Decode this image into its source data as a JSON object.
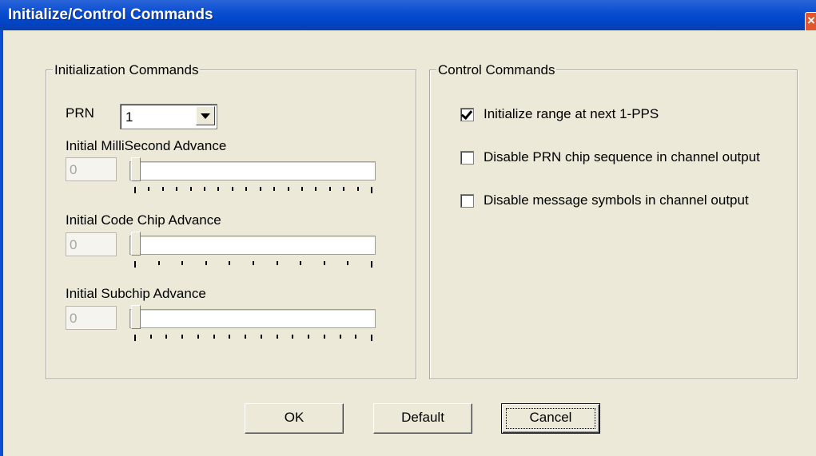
{
  "window": {
    "title": "Initialize/Control Commands",
    "close_glyph": "×"
  },
  "init_group": {
    "title": "Initialization Commands",
    "prn_label": "PRN",
    "prn_value": "1",
    "millisecond": {
      "label": "Initial MilliSecond Advance",
      "value": "0",
      "slider_value": 0
    },
    "code_chip": {
      "label": "Initial Code Chip Advance",
      "value": "0",
      "slider_value": 0
    },
    "subchip": {
      "label": "Initial Subchip Advance",
      "value": "0",
      "slider_value": 0
    }
  },
  "control_group": {
    "title": "Control Commands",
    "checkboxes": [
      {
        "label": "Initialize range at next 1-PPS",
        "checked": true
      },
      {
        "label": "Disable PRN chip sequence in channel output",
        "checked": false
      },
      {
        "label": "Disable message symbols in channel output",
        "checked": false
      }
    ]
  },
  "buttons": {
    "ok": "OK",
    "default": "Default",
    "cancel": "Cancel"
  },
  "colors": {
    "titlebar": "#0a4fd1",
    "dialog_bg": "#ece9d8",
    "close_button": "#e2562f"
  }
}
